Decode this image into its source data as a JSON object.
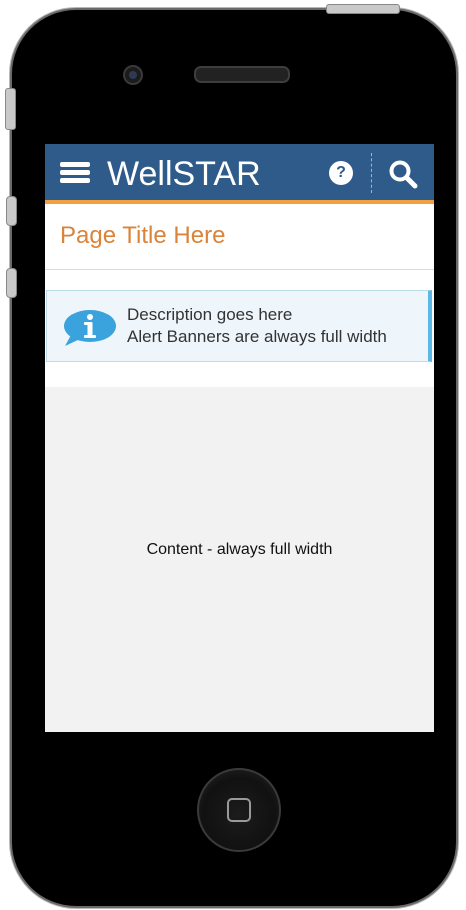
{
  "app": {
    "logo_text": "WellSTAR"
  },
  "header": {
    "menu_icon": "hamburger-icon",
    "help_icon": "help-icon",
    "help_glyph": "?",
    "search_icon": "search-icon",
    "bar_color": "#2f5b8a",
    "accent_color": "#f0a040"
  },
  "page": {
    "title": "Page Title Here"
  },
  "alert": {
    "icon": "info-icon",
    "description": "Description goes here",
    "note": "Alert Banners are always full width",
    "accent_color": "#5bb8e6"
  },
  "content": {
    "text": "Content - always full width"
  },
  "device": {
    "home_button_icon": "home-button-icon"
  }
}
